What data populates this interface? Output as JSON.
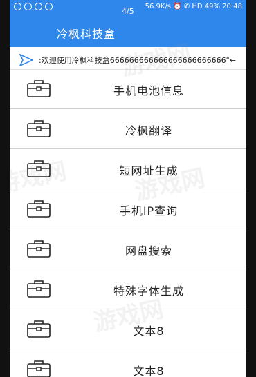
{
  "statusbar": {
    "left_icons": [
      "notification-icon",
      "chat-icon",
      "sync-icon",
      "message-icon"
    ],
    "right": "56.9K/s ⏰ ✆ HD 49% 20:48"
  },
  "pager": "4/5",
  "appbar": {
    "title": "冷枫科技盒"
  },
  "marquee": {
    "text": ":欢迎使用冷枫科技盒666666666666666666666666\"←"
  },
  "items": [
    {
      "label": "手机电池信息"
    },
    {
      "label": "冷枫翻译"
    },
    {
      "label": "短网址生成"
    },
    {
      "label": "手机IP查询"
    },
    {
      "label": "网盘搜索"
    },
    {
      "label": "特殊字体生成"
    },
    {
      "label": "文本8"
    },
    {
      "label": "文本8"
    }
  ],
  "watermark": "游戏网",
  "colors": {
    "primary": "#2f87ec",
    "divider": "#cfcfcf"
  }
}
